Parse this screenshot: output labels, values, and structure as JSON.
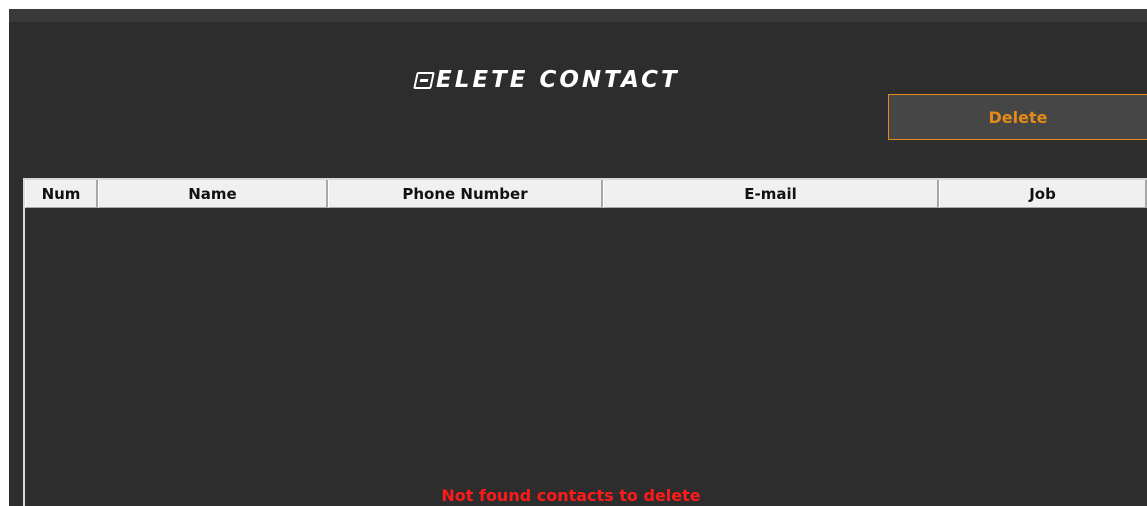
{
  "page": {
    "title_initial": "D",
    "title_rest": "ELETE CONTACT"
  },
  "toolbar": {
    "delete_label": "Delete"
  },
  "table": {
    "columns": [
      "Num",
      "Name",
      "Phone Number",
      "E-mail",
      "Job"
    ],
    "rows": [],
    "empty_message": "Not found contacts to delete"
  },
  "colors": {
    "background": "#2d2d2d",
    "accent": "#e48a1a",
    "error": "#ff1a1a",
    "header_bg": "#f0f0f0"
  }
}
